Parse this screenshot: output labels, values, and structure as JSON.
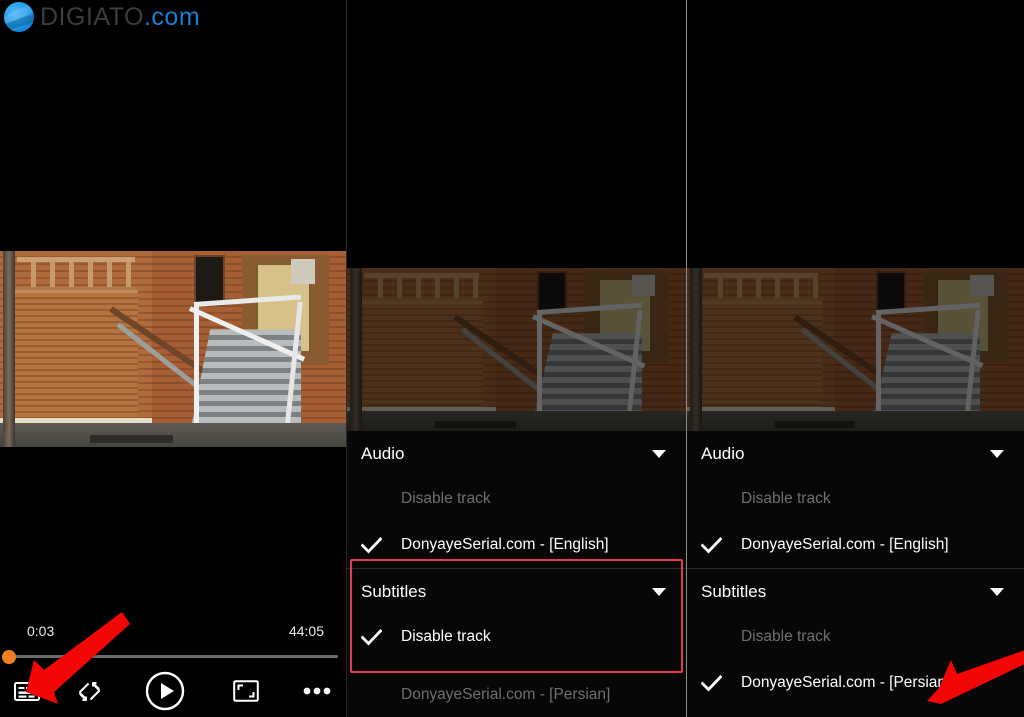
{
  "watermark": {
    "part1": "DIGIATO",
    "part2": ".com",
    "logo_icon": "digiato-globe-icon"
  },
  "colors": {
    "accent_orange": "#f0801f",
    "highlight_red": "#e33b4e",
    "arrow_red": "#f30606",
    "active_text": "#ffffff",
    "disabled_text": "#6f6f6f"
  },
  "player": {
    "current_time": "0:03",
    "total_time": "44:05",
    "progress_percent": 0,
    "controls": [
      {
        "name": "subtitles-button",
        "icon": "closed-caption-icon",
        "label": "Subtitles"
      },
      {
        "name": "rotate-button",
        "icon": "screen-rotate-icon",
        "label": "Rotate"
      },
      {
        "name": "play-button",
        "icon": "play-icon",
        "label": "Play"
      },
      {
        "name": "fit-screen-button",
        "icon": "fit-to-screen-icon",
        "label": "Fit to screen"
      },
      {
        "name": "more-button",
        "icon": "more-options-icon",
        "label": "More options"
      }
    ]
  },
  "panels": [
    {
      "id": "player",
      "menu_visible": false
    },
    {
      "id": "subtitles-disabled",
      "menu_visible": true,
      "highlight_section": "subtitles",
      "sections": [
        {
          "title": "Audio",
          "caret_icon": "chevron-down-icon",
          "options": [
            {
              "label": "Disable track",
              "checked": false
            },
            {
              "label": "DonyayeSerial.com - [English]",
              "checked": true
            }
          ]
        },
        {
          "title": "Subtitles",
          "caret_icon": "chevron-down-icon",
          "options": [
            {
              "label": "Disable track",
              "checked": true
            },
            {
              "label": "DonyayeSerial.com - [Persian]",
              "checked": false
            }
          ]
        }
      ]
    },
    {
      "id": "subtitles-persian-selected",
      "menu_visible": true,
      "highlight_section": null,
      "sections": [
        {
          "title": "Audio",
          "caret_icon": "chevron-down-icon",
          "options": [
            {
              "label": "Disable track",
              "checked": false
            },
            {
              "label": "DonyayeSerial.com - [English]",
              "checked": true
            }
          ]
        },
        {
          "title": "Subtitles",
          "caret_icon": "chevron-down-icon",
          "options": [
            {
              "label": "Disable track",
              "checked": false
            },
            {
              "label": "DonyayeSerial.com - [Persian]",
              "checked": true
            }
          ]
        }
      ]
    }
  ],
  "annotations": [
    {
      "name": "arrow-to-subtitles-button",
      "icon": "red-arrow-icon"
    },
    {
      "name": "arrow-to-persian-subtitle",
      "icon": "red-arrow-icon"
    }
  ]
}
